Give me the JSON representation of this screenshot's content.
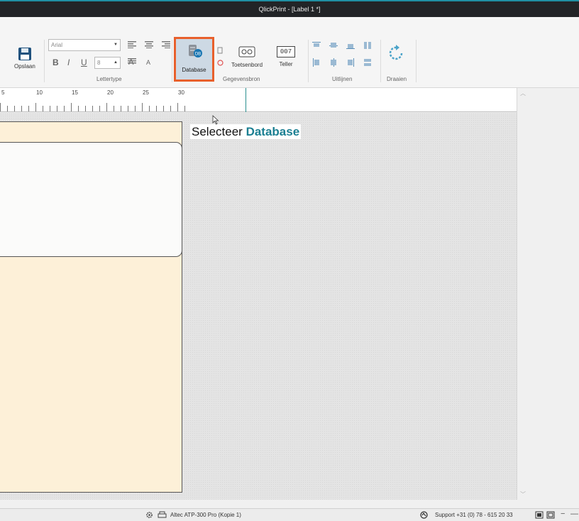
{
  "window": {
    "title": "QlickPrint - [Label 1 *]"
  },
  "ribbon": {
    "save_label": "Opslaan",
    "font_name": "Arial",
    "font_size": "8",
    "bold": "B",
    "italic": "I",
    "underline": "U",
    "grow_font": "A",
    "shrink_font": "A",
    "groups": {
      "font": "Lettertype",
      "datasource": "Gegevensbron",
      "align": "Uitlijnen",
      "rotate": "Draaien"
    },
    "database_label": "Database",
    "keyboard_label": "Toetsenbord",
    "counter_label": "Teller",
    "counter_display": "007"
  },
  "ruler": {
    "marks": [
      "5",
      "10",
      "15",
      "20",
      "25",
      "30"
    ]
  },
  "canvas": {
    "caption_prefix": "Selecteer",
    "caption_highlight": "Database"
  },
  "status": {
    "printer": "Altec ATP-300 Pro (Kopie 1)",
    "support": "Support +31 (0) 78 - 615 20 33"
  },
  "colors": {
    "accent": "#1b7f92",
    "highlight_border": "#e8602c",
    "label_bg": "#fdf0d8"
  }
}
